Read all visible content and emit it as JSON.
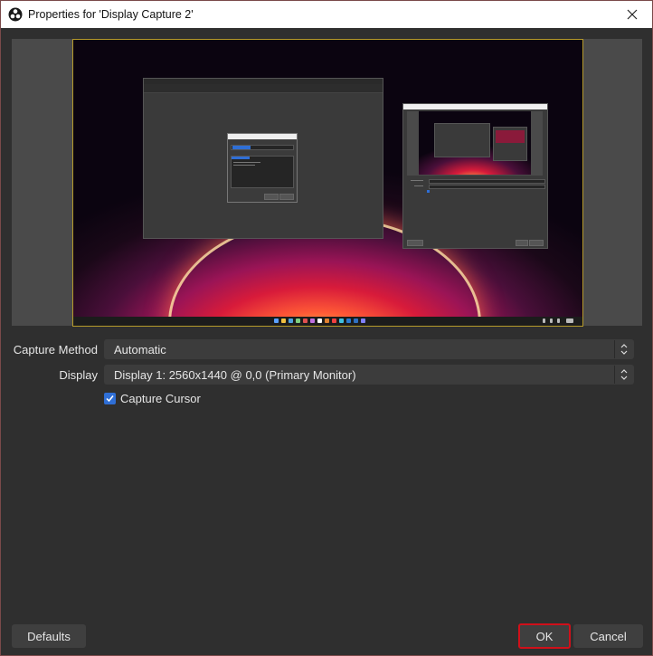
{
  "window": {
    "title": "Properties for 'Display Capture 2'",
    "close_icon": "close-icon",
    "app_icon": "obs-logo-icon"
  },
  "form": {
    "capture_method": {
      "label": "Capture Method",
      "value": "Automatic"
    },
    "display": {
      "label": "Display",
      "value": "Display 1: 2560x1440 @ 0,0 (Primary Monitor)"
    },
    "capture_cursor": {
      "label": "Capture Cursor",
      "checked": true
    }
  },
  "buttons": {
    "defaults": "Defaults",
    "ok": "OK",
    "cancel": "Cancel"
  },
  "colors": {
    "accent": "#2f6fd6",
    "highlight_border": "#d0101a",
    "background": "#2f2f2f",
    "control": "#3c3c3c"
  }
}
